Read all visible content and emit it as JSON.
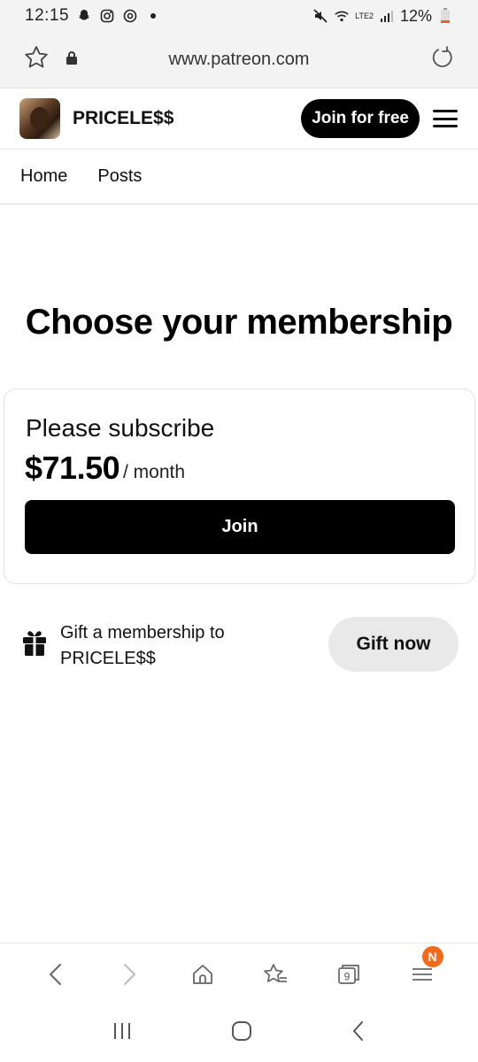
{
  "status_bar": {
    "time": "12:15",
    "battery": "12%",
    "network_label": "LTE2",
    "icons": [
      "snapchat-icon",
      "instagram-icon",
      "threads-icon",
      "dot-icon",
      "mute-icon",
      "wifi-icon",
      "signal-icon",
      "battery-icon"
    ]
  },
  "browser": {
    "url": "www.patreon.com",
    "tabs_count": "9",
    "menu_badge": "N"
  },
  "header": {
    "creator_name": "PRICELE$$",
    "join_free_label": "Join for free"
  },
  "tabs": [
    {
      "label": "Home"
    },
    {
      "label": "Posts"
    }
  ],
  "main": {
    "title": "Choose your membership",
    "tier": {
      "name": "Please subscribe",
      "price": "$71.50",
      "period": "/ month",
      "join_label": "Join"
    },
    "gift": {
      "text": "Gift a membership to PRICELE$$",
      "button_label": "Gift now"
    }
  },
  "colors": {
    "primary": "#000000",
    "badge": "#f26a1b",
    "gift_button_bg": "#e9e9e9"
  }
}
